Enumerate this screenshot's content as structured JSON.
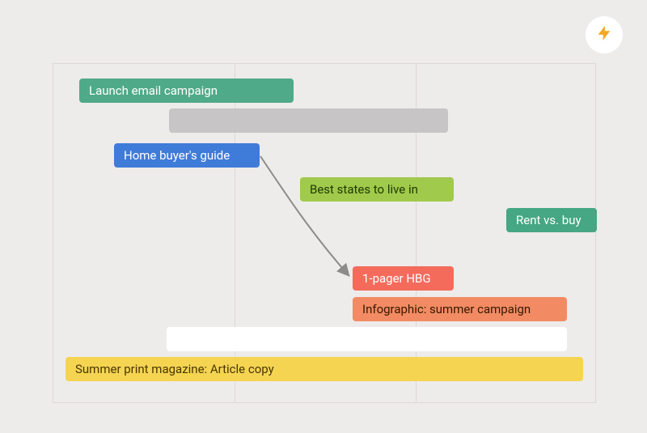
{
  "badge_icon": "lightning-icon",
  "tasks": {
    "launch_email": "Launch email campaign",
    "home_buyer": "Home buyer's guide",
    "best_states": "Best states to live in",
    "rent_vs_buy": "Rent vs. buy",
    "one_pager": "1-pager HBG",
    "infographic": "Infographic: summer campaign",
    "summer_print": "Summer print magazine: Article copy"
  }
}
